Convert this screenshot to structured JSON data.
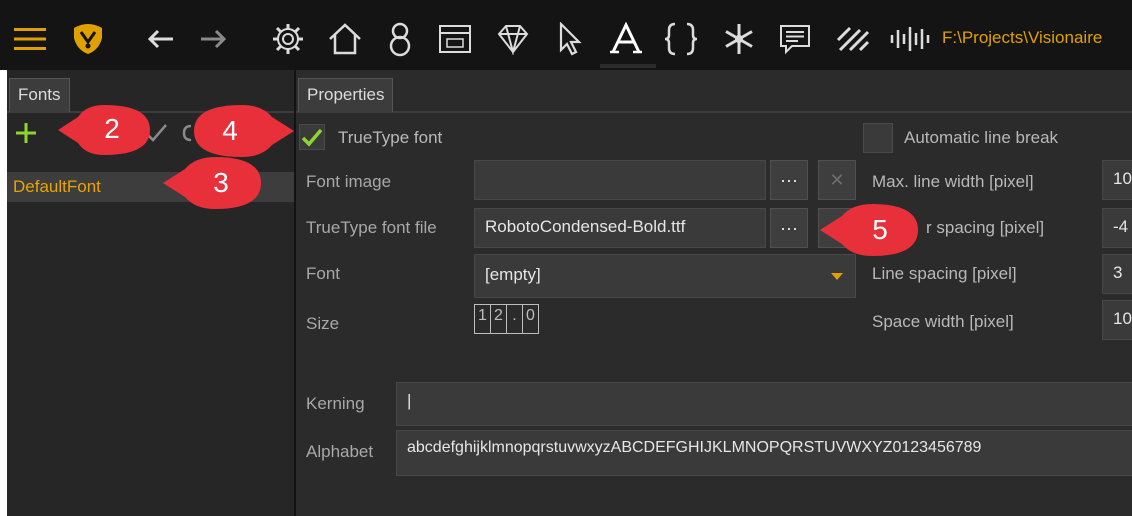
{
  "toolbar": {
    "icons": [
      "hamburger-menu-icon",
      "logo-icon",
      "back-arrow-icon",
      "forward-arrow-icon",
      "gear-icon",
      "home-icon",
      "characters-icon",
      "interface-window-icon",
      "diamond-icon",
      "cursor-icon",
      "font-icon",
      "braces-icon",
      "snowflake-icon",
      "dialog-icon",
      "stripes-icon",
      "audio-icon"
    ],
    "project_path": "F:\\Projects\\Visionaire",
    "colors": {
      "logo": "#e0a100",
      "menu": "#e0a100"
    }
  },
  "fonts_panel": {
    "tab_label": "Fonts",
    "items": [
      {
        "label": "DefaultFont"
      }
    ]
  },
  "properties": {
    "tab_label": "Properties",
    "truetype_font_label": "TrueType font",
    "truetype_font_checked": true,
    "automatic_line_break_label": "Automatic line break",
    "automatic_line_break_checked": false,
    "font_image_label": "Font image",
    "font_image_value": "",
    "truetype_file_label": "TrueType font file",
    "truetype_file_value": "RobotoCondensed-Bold.ttf",
    "browse_label": "···",
    "clear_label": "✕",
    "font_label": "Font",
    "font_value": "[empty]",
    "size_label": "Size",
    "size_digits": [
      "1",
      "2",
      ".",
      "0"
    ],
    "max_line_width_label": "Max. line width [pixel]",
    "max_line_width_value": "10",
    "char_spacing_label": "r spacing [pixel]",
    "char_spacing_value": "-4",
    "line_spacing_label": "Line spacing [pixel]",
    "line_spacing_value": "3",
    "space_width_label": "Space width [pixel]",
    "space_width_value": "10",
    "kerning_label": "Kerning",
    "kerning_value": "|",
    "alphabet_label": "Alphabet",
    "alphabet_value": "abcdefghijklmnopqrstuvwxyzABCDEFGHIJKLMNOPQRSTUVWXYZ0123456789"
  },
  "callouts": [
    "2",
    "3",
    "4",
    "5"
  ],
  "accent_colors": {
    "callout": "#e8303a",
    "check": "#8dd630",
    "add": "#8dd630",
    "dropdown": "#e0a100"
  }
}
